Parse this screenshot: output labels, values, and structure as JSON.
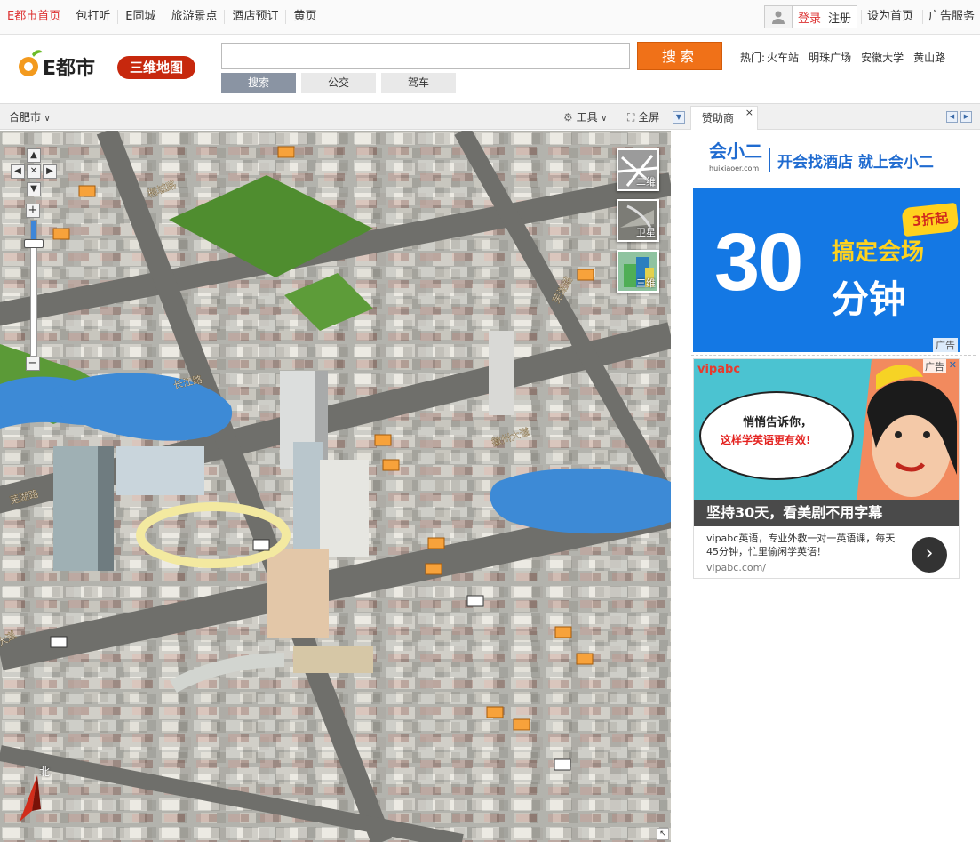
{
  "topnav": {
    "links": [
      "E都市首页",
      "包打听",
      "E同城",
      "旅游景点",
      "酒店预订",
      "黄页"
    ],
    "login": "登录",
    "register": "注册",
    "set_home": "设为首页",
    "ad_service": "广告服务"
  },
  "header": {
    "logo_text": "E都市",
    "badge": "三维地图",
    "search_button": "搜索",
    "search_value": "",
    "tabs": [
      "搜索",
      "公交",
      "驾车"
    ],
    "hot_label": "热门:",
    "hot_links": [
      "火车站",
      "明珠广场",
      "安徽大学",
      "黄山路"
    ]
  },
  "maptool": {
    "city": "合肥市",
    "tools": "工具",
    "fullscreen": "全屏"
  },
  "map": {
    "modes": [
      "二维",
      "卫星",
      "三维"
    ],
    "compass_north": "北",
    "zoom_in": "+",
    "zoom_out": "−",
    "road_labels": [
      "桐城路",
      "芜湖路",
      "长江路",
      "徽州大道",
      "芜湖路",
      "大道"
    ]
  },
  "sidebar": {
    "tab": "赞助商",
    "close": "×",
    "ad1": {
      "brand": "会小二",
      "brand_sub": "huixiaoer.com",
      "slogan": "开会找酒店 就上会小二",
      "number": "30",
      "line1": "搞定会场",
      "line2": "分钟",
      "tag": "3折起",
      "label": "广告"
    },
    "ad2": {
      "brand": "vipabc",
      "label": "广告",
      "bubble1": "悄悄告诉你，",
      "bubble2": "这样学英语更有效!",
      "bar": "坚持30天，看美剧不用字幕",
      "desc": "vipabc英语，专业外教一对一英语课，每天45分钟，忙里偷闲学英语！",
      "url": "vipabc.com/"
    }
  },
  "colors": {
    "accent_orange": "#f07118",
    "brand_red": "#c7280d",
    "ad_blue": "#1478e4",
    "ad_yellow": "#ffd21e"
  }
}
